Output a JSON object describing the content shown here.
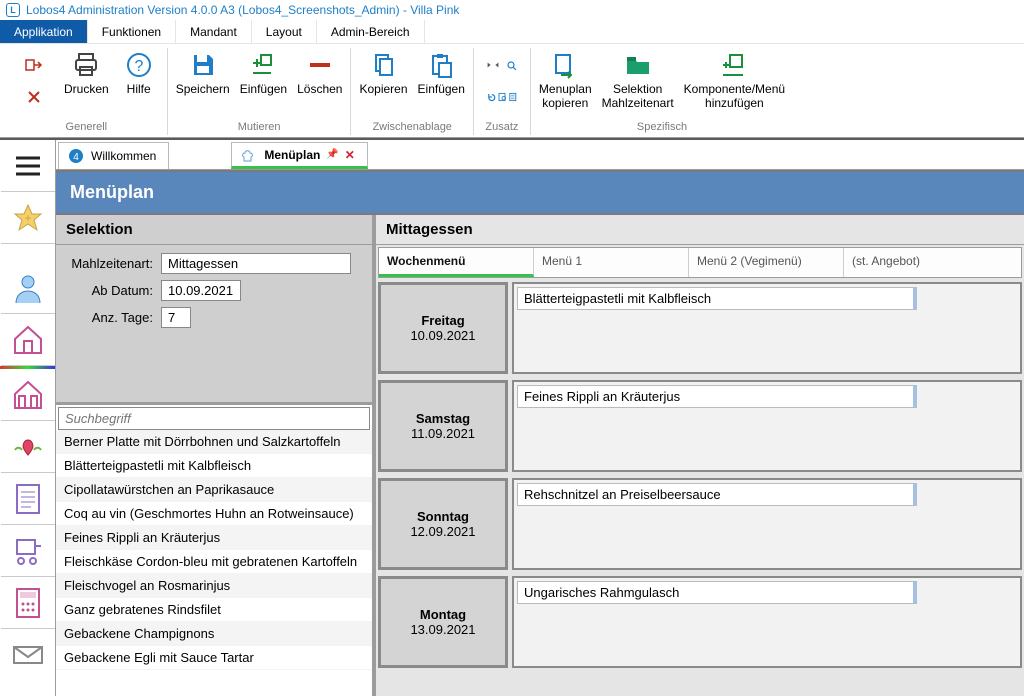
{
  "window": {
    "title": "Lobos4 Administration Version 4.0.0 A3 (Lobos4_Screenshots_Admin) - Villa Pink"
  },
  "menubar": [
    {
      "label": "Applikation",
      "active": true
    },
    {
      "label": "Funktionen"
    },
    {
      "label": "Mandant"
    },
    {
      "label": "Layout"
    },
    {
      "label": "Admin-Bereich"
    }
  ],
  "ribbon": {
    "groups": [
      {
        "label": "Generell",
        "buttons": [
          "Drucken",
          "Hilfe"
        ]
      },
      {
        "label": "Mutieren",
        "buttons": [
          "Speichern",
          "Einfügen",
          "Löschen"
        ]
      },
      {
        "label": "Zwischenablage",
        "buttons": [
          "Kopieren",
          "Einfügen"
        ]
      },
      {
        "label": "Zusatz",
        "buttons": [
          "",
          ""
        ]
      },
      {
        "label": "Spezifisch",
        "buttons": [
          "Menuplan\nkopieren",
          "Selektion\nMahlzeitenart",
          "Komponente/Menü\nhinzufügen"
        ]
      }
    ]
  },
  "tabs": [
    {
      "label": "Willkommen",
      "active": false
    },
    {
      "label": "Menüplan",
      "active": true
    }
  ],
  "page": {
    "title": "Menüplan"
  },
  "selection": {
    "title": "Selektion",
    "mahlzeitenart_label": "Mahlzeitenart:",
    "mahlzeitenart_value": "Mittagessen",
    "abdatum_label": "Ab Datum:",
    "abdatum_value": "10.09.2021",
    "anztage_label": "Anz. Tage:",
    "anztage_value": "7",
    "search_placeholder": "Suchbegriff",
    "results": [
      "Berner Platte mit Dörrbohnen und Salzkartoffeln",
      "Blätterteigpastetli mit Kalbfleisch",
      "Cipollatawürstchen an Paprikasauce",
      "Coq au vin (Geschmortes Huhn an Rotweinsauce)",
      "Feines Rippli an Kräuterjus",
      "Fleischkäse Cordon-bleu mit gebratenen Kartoffeln",
      "Fleischvogel an Rosmarinjus",
      "Ganz gebratenes Rindsfilet",
      "Gebackene Champignons",
      "Gebackene Egli mit Sauce Tartar"
    ]
  },
  "meal": {
    "title": "Mittagessen",
    "columns": [
      "Wochenmenü",
      "Menü 1",
      "Menü 2 (Vegimenü)",
      "(st. Angebot)"
    ],
    "days": [
      {
        "name": "Freitag",
        "date": "10.09.2021",
        "dish": "Blätterteigpastetli mit Kalbfleisch"
      },
      {
        "name": "Samstag",
        "date": "11.09.2021",
        "dish": "Feines Rippli an Kräuterjus"
      },
      {
        "name": "Sonntag",
        "date": "12.09.2021",
        "dish": "Rehschnitzel an Preiselbeersauce"
      },
      {
        "name": "Montag",
        "date": "13.09.2021",
        "dish": "Ungarisches Rahmgulasch"
      }
    ]
  }
}
